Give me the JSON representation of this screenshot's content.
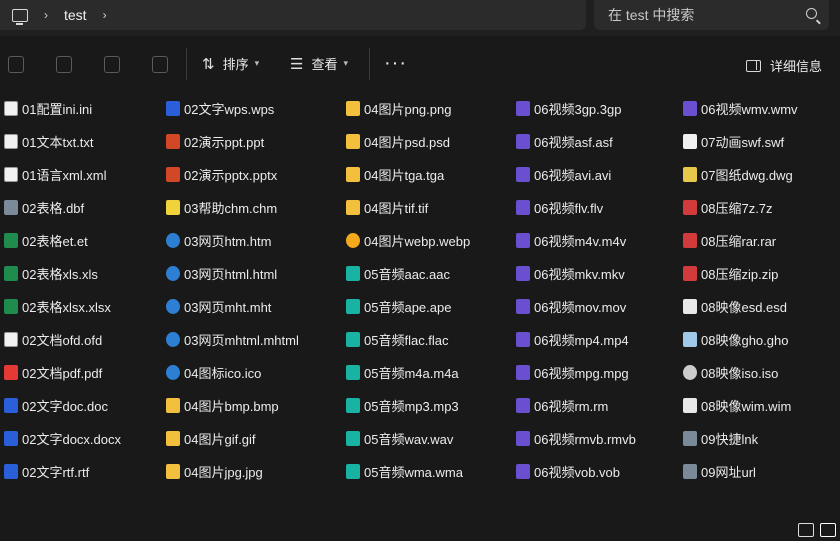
{
  "address": {
    "crumb": "test"
  },
  "search": {
    "placeholder": "在 test 中搜索"
  },
  "toolbar": {
    "sort_label": "排序",
    "view_label": "查看",
    "more_label": "···",
    "details_label": "详细信息"
  },
  "columns": [
    [
      {
        "name": "01配置ini.ini",
        "icon": "doc"
      },
      {
        "name": "01文本txt.txt",
        "icon": "doc"
      },
      {
        "name": "01语言xml.xml",
        "icon": "doc"
      },
      {
        "name": "02表格.dbf",
        "icon": "grey"
      },
      {
        "name": "02表格et.et",
        "icon": "xls"
      },
      {
        "name": "02表格xls.xls",
        "icon": "xls"
      },
      {
        "name": "02表格xlsx.xlsx",
        "icon": "xls"
      },
      {
        "name": "02文档ofd.ofd",
        "icon": "doc"
      },
      {
        "name": "02文档pdf.pdf",
        "icon": "pdf"
      },
      {
        "name": "02文字doc.doc",
        "icon": "word"
      },
      {
        "name": "02文字docx.docx",
        "icon": "word"
      },
      {
        "name": "02文字rtf.rtf",
        "icon": "word"
      }
    ],
    [
      {
        "name": "02文字wps.wps",
        "icon": "word"
      },
      {
        "name": "02演示ppt.ppt",
        "icon": "ppt"
      },
      {
        "name": "02演示pptx.pptx",
        "icon": "ppt"
      },
      {
        "name": "03帮助chm.chm",
        "icon": "chm"
      },
      {
        "name": "03网页htm.htm",
        "icon": "web"
      },
      {
        "name": "03网页html.html",
        "icon": "web"
      },
      {
        "name": "03网页mht.mht",
        "icon": "web"
      },
      {
        "name": "03网页mhtml.mhtml",
        "icon": "web"
      },
      {
        "name": "04图标ico.ico",
        "icon": "info"
      },
      {
        "name": "04图片bmp.bmp",
        "icon": "img"
      },
      {
        "name": "04图片gif.gif",
        "icon": "img"
      },
      {
        "name": "04图片jpg.jpg",
        "icon": "img"
      }
    ],
    [
      {
        "name": "04图片png.png",
        "icon": "img"
      },
      {
        "name": "04图片psd.psd",
        "icon": "img"
      },
      {
        "name": "04图片tga.tga",
        "icon": "img"
      },
      {
        "name": "04图片tif.tif",
        "icon": "img"
      },
      {
        "name": "04图片webp.webp",
        "icon": "sun"
      },
      {
        "name": "05音频aac.aac",
        "icon": "aud"
      },
      {
        "name": "05音频ape.ape",
        "icon": "aud"
      },
      {
        "name": "05音频flac.flac",
        "icon": "aud"
      },
      {
        "name": "05音频m4a.m4a",
        "icon": "aud"
      },
      {
        "name": "05音频mp3.mp3",
        "icon": "aud"
      },
      {
        "name": "05音频wav.wav",
        "icon": "aud"
      },
      {
        "name": "05音频wma.wma",
        "icon": "aud"
      }
    ],
    [
      {
        "name": "06视频3gp.3gp",
        "icon": "vid"
      },
      {
        "name": "06视频asf.asf",
        "icon": "vid"
      },
      {
        "name": "06视频avi.avi",
        "icon": "vid"
      },
      {
        "name": "06视频flv.flv",
        "icon": "vid"
      },
      {
        "name": "06视频m4v.m4v",
        "icon": "vid"
      },
      {
        "name": "06视频mkv.mkv",
        "icon": "vid"
      },
      {
        "name": "06视频mov.mov",
        "icon": "vid"
      },
      {
        "name": "06视频mp4.mp4",
        "icon": "vid"
      },
      {
        "name": "06视频mpg.mpg",
        "icon": "vid"
      },
      {
        "name": "06视频rm.rm",
        "icon": "vid"
      },
      {
        "name": "06视频rmvb.rmvb",
        "icon": "vid"
      },
      {
        "name": "06视频vob.vob",
        "icon": "vid"
      }
    ],
    [
      {
        "name": "06视频wmv.wmv",
        "icon": "vid"
      },
      {
        "name": "07动画swf.swf",
        "icon": "swf"
      },
      {
        "name": "07图纸dwg.dwg",
        "icon": "dwg"
      },
      {
        "name": "08压缩7z.7z",
        "icon": "zip"
      },
      {
        "name": "08压缩rar.rar",
        "icon": "zip"
      },
      {
        "name": "08压缩zip.zip",
        "icon": "zip"
      },
      {
        "name": "08映像esd.esd",
        "icon": "dark"
      },
      {
        "name": "08映像gho.gho",
        "icon": "gho"
      },
      {
        "name": "08映像iso.iso",
        "icon": "iso"
      },
      {
        "name": "08映像wim.wim",
        "icon": "dark"
      },
      {
        "name": "09快捷lnk",
        "icon": "grey"
      },
      {
        "name": "09网址url",
        "icon": "grey"
      }
    ]
  ]
}
